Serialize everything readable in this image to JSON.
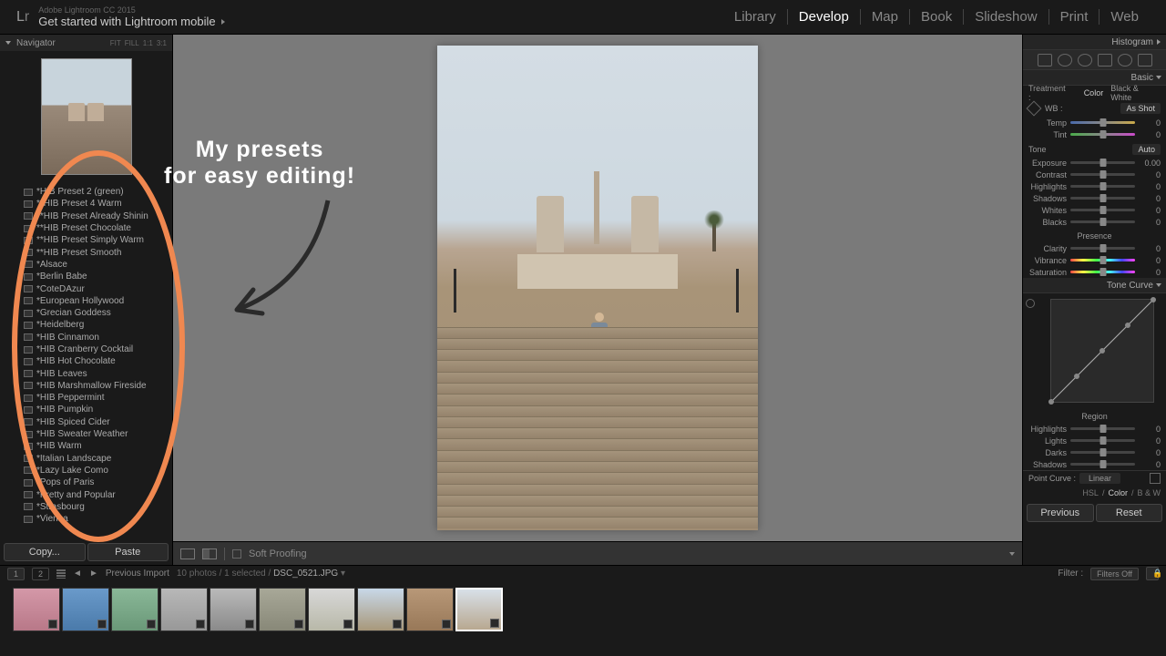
{
  "header": {
    "logo_l": "L",
    "logo_r": "r",
    "subtitle": "Adobe Lightroom CC 2015",
    "title": "Get started with Lightroom mobile"
  },
  "modules": [
    "Library",
    "Develop",
    "Map",
    "Book",
    "Slideshow",
    "Print",
    "Web"
  ],
  "active_module": "Develop",
  "navigator": {
    "title": "Navigator",
    "zoom": [
      "FIT",
      "FILL",
      "1:1",
      "3:1"
    ]
  },
  "presets": [
    "*HIB Preset 2 (green)",
    "**HIB Preset 4 Warm",
    "**HIB Preset Already Shinin",
    "**HIB Preset Chocolate",
    "**HIB Preset Simply Warm",
    "**HIB Preset Smooth",
    "*Alsace",
    "*Berlin Babe",
    "*CoteDAzur",
    "*European Hollywood",
    "*Grecian Goddess",
    "*Heidelberg",
    "*HIB Cinnamon",
    "*HIB Cranberry Cocktail",
    "*HIB Hot Chocolate",
    "*HIB Leaves",
    "*HIB Marshmallow Fireside",
    "*HIB Peppermint",
    "*HIB Pumpkin",
    "*HIB Spiced Cider",
    "*HIB Sweater Weather",
    "*HIB Warm",
    "*Italian Landscape",
    "*Lazy Lake Como",
    "*Pops of Paris",
    "*Pretty and Popular",
    "*Strasbourg",
    "*Vienna"
  ],
  "buttons": {
    "copy": "Copy...",
    "paste": "Paste",
    "previous": "Previous",
    "reset": "Reset"
  },
  "soft_proof": "Soft Proofing",
  "right": {
    "histogram": "Histogram",
    "basic": "Basic",
    "treatment": "Treatment :",
    "color": "Color",
    "bw": "Black & White",
    "wb": "WB :",
    "wb_val": "As Shot",
    "tone": "Tone",
    "auto": "Auto",
    "presence": "Presence",
    "tone_curve": "Tone Curve",
    "region": "Region",
    "point_curve": "Point Curve :",
    "linear": "Linear",
    "hsl": "HSL",
    "color2": "Color",
    "bw2": "B & W"
  },
  "sliders": {
    "temp": {
      "label": "Temp",
      "val": "0"
    },
    "tint": {
      "label": "Tint",
      "val": "0"
    },
    "exposure": {
      "label": "Exposure",
      "val": "0.00"
    },
    "contrast": {
      "label": "Contrast",
      "val": "0"
    },
    "highlights": {
      "label": "Highlights",
      "val": "0"
    },
    "shadows": {
      "label": "Shadows",
      "val": "0"
    },
    "whites": {
      "label": "Whites",
      "val": "0"
    },
    "blacks": {
      "label": "Blacks",
      "val": "0"
    },
    "clarity": {
      "label": "Clarity",
      "val": "0"
    },
    "vibrance": {
      "label": "Vibrance",
      "val": "0"
    },
    "saturation": {
      "label": "Saturation",
      "val": "0"
    },
    "r_highlights": {
      "label": "Highlights",
      "val": "0"
    },
    "r_lights": {
      "label": "Lights",
      "val": "0"
    },
    "r_darks": {
      "label": "Darks",
      "val": "0"
    },
    "r_shadows": {
      "label": "Shadows",
      "val": "0"
    }
  },
  "filmstrip": {
    "prev_import": "Previous Import",
    "count": "10 photos / 1 selected /",
    "filename": "DSC_0521.JPG",
    "filter": "Filter :",
    "filters_off": "Filters Off",
    "one": "1",
    "two": "2"
  },
  "annotation": {
    "line1": "My presets",
    "line2": "for easy editing!"
  }
}
